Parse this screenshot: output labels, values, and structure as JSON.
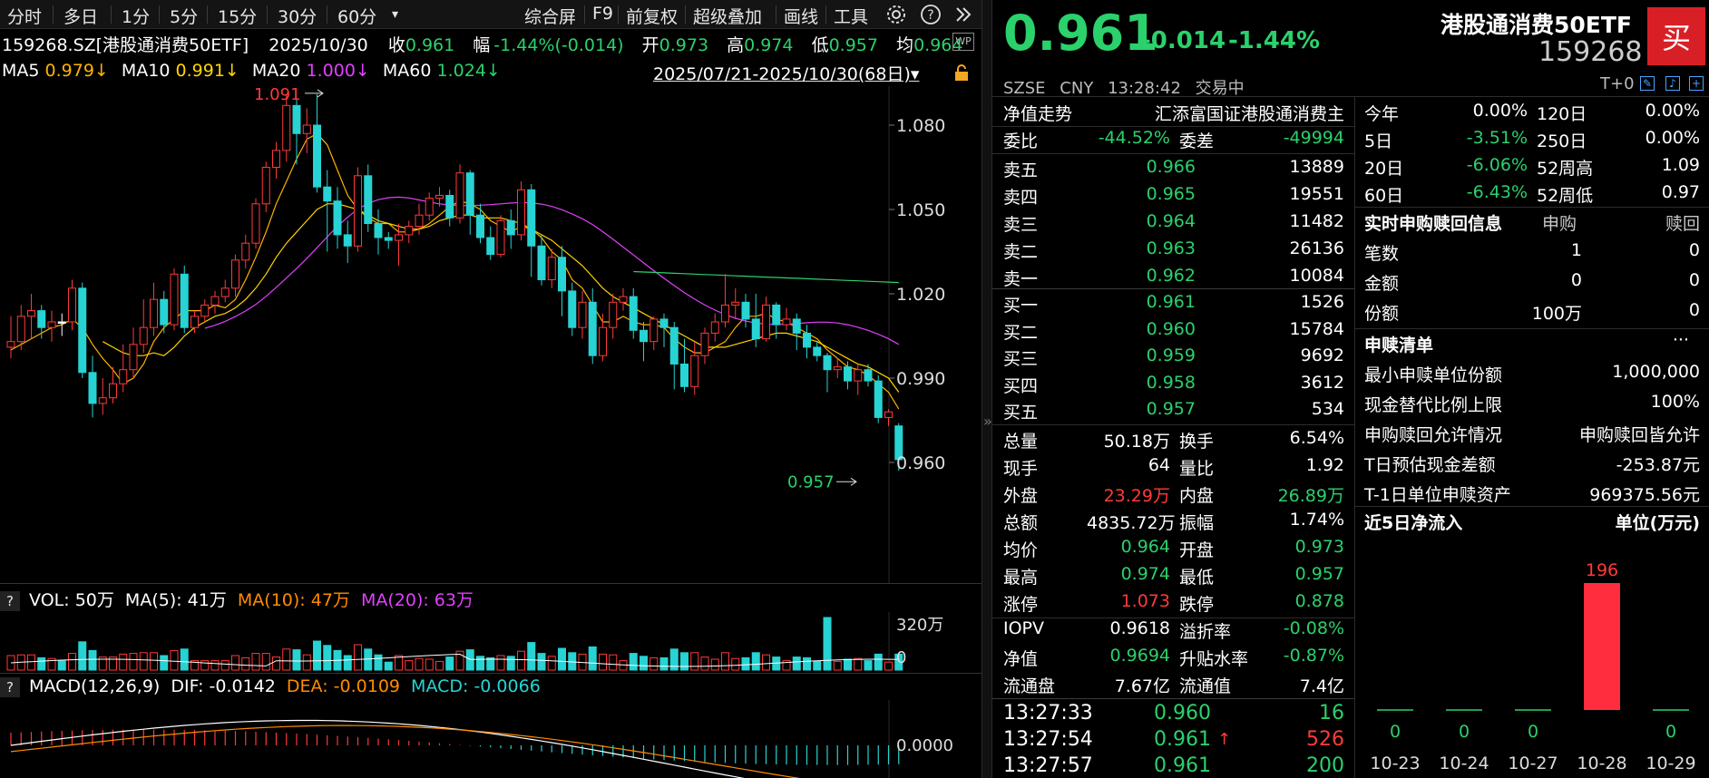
{
  "toolbar": {
    "periods": [
      "分时",
      "多日",
      "1分",
      "5分",
      "15分",
      "30分",
      "60分"
    ],
    "dropdown_symbol": "▾",
    "right_items": [
      "综合屏",
      "F9",
      "前复权",
      "超级叠加",
      "画线",
      "工具"
    ]
  },
  "quote_line": {
    "code_name": "159268.SZ[港股通消费50ETF]",
    "date": "2025/10/30",
    "close_label": "收",
    "close": "0.961",
    "change_label": "幅",
    "change": "-1.44%(-0.014)",
    "open_label": "开",
    "open": "0.973",
    "high_label": "高",
    "high": "0.974",
    "low_label": "低",
    "low": "0.957",
    "avg_label": "均",
    "avg": "0.964"
  },
  "ma_line": {
    "ma5_label": "MA5",
    "ma5": "0.979↓",
    "ma10_label": "MA10",
    "ma10": "0.991↓",
    "ma20_label": "MA20",
    "ma20": "1.000↓",
    "ma60_label": "MA60",
    "ma60": "1.024↓",
    "range": "2025/07/21-2025/10/30(68日)",
    "range_dropdown": "▾"
  },
  "chart_data": {
    "type": "candlestick",
    "price_axis_ticks": [
      "1.080",
      "1.050",
      "1.020",
      "0.990",
      "0.960"
    ],
    "max_label": "1.091",
    "min_label": "0.957",
    "colors": {
      "up": "#ff3a3a",
      "down": "#27d3d3",
      "ma5": "#ffffff",
      "ma10": "#ffd400",
      "ma20": "#e040fb",
      "ma60": "#2bd16b"
    },
    "candles": [
      [
        1.001,
        1.003,
        0.997,
        1.012
      ],
      [
        1.003,
        1.012,
        1.0,
        1.016
      ],
      [
        1.012,
        1.014,
        1.004,
        1.02
      ],
      [
        1.014,
        1.008,
        1.004,
        1.016
      ],
      [
        1.008,
        1.01,
        1.003,
        1.014
      ],
      [
        1.01,
        1.01,
        1.005,
        1.013
      ],
      [
        1.01,
        1.022,
        1.007,
        1.025
      ],
      [
        1.022,
        0.992,
        0.99,
        1.024
      ],
      [
        0.992,
        0.981,
        0.976,
        0.998
      ],
      [
        0.981,
        0.983,
        0.977,
        0.99
      ],
      [
        0.983,
        0.988,
        0.981,
        0.994
      ],
      [
        0.988,
        0.993,
        0.985,
        1.002
      ],
      [
        0.993,
        1.002,
        0.99,
        1.008
      ],
      [
        1.002,
        1.008,
        0.999,
        1.018
      ],
      [
        1.008,
        1.018,
        1.005,
        1.024
      ],
      [
        1.018,
        1.009,
        1.006,
        1.021
      ],
      [
        1.009,
        1.027,
        1.007,
        1.029
      ],
      [
        1.027,
        1.008,
        1.006,
        1.03
      ],
      [
        1.008,
        1.012,
        1.006,
        1.014
      ],
      [
        1.012,
        1.016,
        1.01,
        1.018
      ],
      [
        1.016,
        1.019,
        1.013,
        1.021
      ],
      [
        1.019,
        1.022,
        1.017,
        1.025
      ],
      [
        1.022,
        1.032,
        1.019,
        1.034
      ],
      [
        1.032,
        1.038,
        1.029,
        1.041
      ],
      [
        1.038,
        1.052,
        1.036,
        1.054
      ],
      [
        1.052,
        1.065,
        1.049,
        1.067
      ],
      [
        1.065,
        1.071,
        1.061,
        1.074
      ],
      [
        1.071,
        1.087,
        1.067,
        1.091
      ],
      [
        1.087,
        1.077,
        1.066,
        1.089
      ],
      [
        1.077,
        1.08,
        1.07,
        1.086
      ],
      [
        1.08,
        1.058,
        1.056,
        1.091
      ],
      [
        1.058,
        1.053,
        1.035,
        1.064
      ],
      [
        1.053,
        1.041,
        1.036,
        1.058
      ],
      [
        1.041,
        1.037,
        1.031,
        1.046
      ],
      [
        1.037,
        1.062,
        1.035,
        1.065
      ],
      [
        1.062,
        1.045,
        1.042,
        1.066
      ],
      [
        1.045,
        1.04,
        1.034,
        1.05
      ],
      [
        1.04,
        1.039,
        1.036,
        1.042
      ],
      [
        1.039,
        1.041,
        1.03,
        1.045
      ],
      [
        1.041,
        1.044,
        1.038,
        1.046
      ],
      [
        1.044,
        1.048,
        1.041,
        1.052
      ],
      [
        1.048,
        1.054,
        1.046,
        1.056
      ],
      [
        1.054,
        1.055,
        1.051,
        1.058
      ],
      [
        1.055,
        1.047,
        1.044,
        1.057
      ],
      [
        1.047,
        1.063,
        1.045,
        1.066
      ],
      [
        1.063,
        1.048,
        1.041,
        1.064
      ],
      [
        1.048,
        1.04,
        1.038,
        1.052
      ],
      [
        1.04,
        1.034,
        1.032,
        1.044
      ],
      [
        1.034,
        1.046,
        1.033,
        1.048
      ],
      [
        1.046,
        1.041,
        1.036,
        1.05
      ],
      [
        1.041,
        1.057,
        1.039,
        1.06
      ],
      [
        1.057,
        1.037,
        1.026,
        1.059
      ],
      [
        1.037,
        1.025,
        1.023,
        1.041
      ],
      [
        1.025,
        1.033,
        1.022,
        1.036
      ],
      [
        1.033,
        1.021,
        1.012,
        1.037
      ],
      [
        1.021,
        1.008,
        1.005,
        1.024
      ],
      [
        1.008,
        1.017,
        1.004,
        1.021
      ],
      [
        1.017,
        0.998,
        0.995,
        1.022
      ],
      [
        0.998,
        1.008,
        0.996,
        1.013
      ],
      [
        1.008,
        1.017,
        1.004,
        1.02
      ],
      [
        1.017,
        1.019,
        1.014,
        1.022
      ],
      [
        1.019,
        1.007,
        1.004,
        1.022
      ],
      [
        1.007,
        1.003,
        0.996,
        1.01
      ],
      [
        1.003,
        1.011,
        1.0,
        1.012
      ],
      [
        1.011,
        1.008,
        1.001,
        1.013
      ],
      [
        1.008,
        0.995,
        0.986,
        1.01
      ],
      [
        0.995,
        0.987,
        0.985,
        1.004
      ],
      [
        0.987,
        0.998,
        0.984,
        1.003
      ],
      [
        0.998,
        1.006,
        0.995,
        1.008
      ],
      [
        1.006,
        1.01,
        1.003,
        1.013
      ],
      [
        1.01,
        1.016,
        1.008,
        1.027
      ],
      [
        1.016,
        1.017,
        1.011,
        1.022
      ],
      [
        1.017,
        1.011,
        1.008,
        1.02
      ],
      [
        1.011,
        1.004,
        1.001,
        1.02
      ],
      [
        1.004,
        1.016,
        1.003,
        1.019
      ],
      [
        1.016,
        1.009,
        1.004,
        1.017
      ],
      [
        1.009,
        1.011,
        1.007,
        1.015
      ],
      [
        1.011,
        1.006,
        1.0,
        1.013
      ],
      [
        1.006,
        1.001,
        0.997,
        1.009
      ],
      [
        1.001,
        0.998,
        0.996,
        1.003
      ],
      [
        0.998,
        0.993,
        0.985,
        0.999
      ],
      [
        0.993,
        0.994,
        0.99,
        0.997
      ],
      [
        0.994,
        0.989,
        0.986,
        0.996
      ],
      [
        0.989,
        0.993,
        0.984,
        0.995
      ],
      [
        0.993,
        0.989,
        0.987,
        0.995
      ],
      [
        0.989,
        0.976,
        0.974,
        0.991
      ],
      [
        0.976,
        0.978,
        0.973,
        0.979
      ],
      [
        0.973,
        0.961,
        0.957,
        0.974
      ]
    ],
    "ma5": [
      1.0,
      1.002,
      1.004,
      1.006,
      1.008,
      1.009,
      1.011,
      1.008,
      1.002,
      0.997,
      0.993,
      0.988,
      0.99,
      0.995,
      1.003,
      1.008,
      1.011,
      1.014,
      1.014,
      1.014,
      1.016,
      1.015,
      1.018,
      1.025,
      1.033,
      1.042,
      1.052,
      1.06,
      1.068,
      1.075,
      1.077,
      1.073,
      1.064,
      1.055,
      1.05,
      1.047,
      1.045,
      1.045,
      1.042,
      1.042,
      1.043,
      1.045,
      1.048,
      1.051,
      1.053,
      1.052,
      1.05,
      1.046,
      1.044,
      1.042,
      1.044,
      1.043,
      1.04,
      1.035,
      1.032,
      1.025,
      1.022,
      1.016,
      1.01,
      1.01,
      1.012,
      1.01,
      1.009,
      1.009,
      1.008,
      1.004,
      1.001,
      0.999,
      0.999,
      1.001,
      1.003,
      1.008,
      1.012,
      1.012,
      1.013,
      1.011,
      1.01,
      1.008,
      1.006,
      1.004,
      1.0,
      0.997,
      0.994,
      0.993,
      0.991,
      0.988,
      0.985,
      0.979
    ],
    "ma10": [
      null,
      null,
      null,
      null,
      null,
      null,
      null,
      null,
      null,
      1.003,
      1.001,
      0.999,
      0.998,
      0.998,
      0.999,
      0.998,
      1.001,
      1.005,
      1.008,
      1.01,
      1.012,
      1.013,
      1.015,
      1.018,
      1.022,
      1.027,
      1.033,
      1.038,
      1.042,
      1.046,
      1.05,
      1.052,
      1.052,
      1.051,
      1.05,
      1.048,
      1.046,
      1.045,
      1.044,
      1.043,
      1.043,
      1.044,
      1.046,
      1.047,
      1.048,
      1.048,
      1.047,
      1.047,
      1.047,
      1.046,
      1.045,
      1.043,
      1.041,
      1.039,
      1.036,
      1.033,
      1.03,
      1.026,
      1.022,
      1.019,
      1.017,
      1.015,
      1.013,
      1.011,
      1.009,
      1.007,
      1.005,
      1.003,
      1.001,
      1.001,
      1.001,
      1.002,
      1.003,
      1.004,
      1.005,
      1.006,
      1.006,
      1.005,
      1.004,
      1.003,
      1.001,
      0.999,
      0.997,
      0.995,
      0.994,
      0.992,
      0.99,
      0.985
    ]
  },
  "axis_labels_price": {
    "t1080": "1.080",
    "t1050": "1.050",
    "t1020": "1.020",
    "t0990": "0.990",
    "t0960": "0.960"
  },
  "volume_panel": {
    "help": "?",
    "vol_label": "VOL: 50万",
    "ma5_label": "MA(5): 41万",
    "ma10_label": "MA(10): 47万",
    "ma20_label": "MA(20): 63万",
    "axis_top": "320万",
    "axis_zero": "0"
  },
  "macd_panel": {
    "help": "?",
    "title": "MACD(12,26,9)",
    "dif": "DIF: -0.0142",
    "dea": "DEA: -0.0109",
    "macd": "MACD: -0.0066",
    "axis_zero": "0.0000"
  },
  "header": {
    "price": "0.961",
    "change": "-0.014",
    "change_pct": "-1.44%",
    "name": "港股通消费50ETF",
    "code": "159268",
    "buy_badge": "买",
    "exchange": "SZSE",
    "currency": "CNY",
    "time": "13:28:42",
    "status": "交易中",
    "t0": "T+0"
  },
  "order_book": {
    "nav_tab": "净值走势",
    "index_name": "汇添富国证港股通消费主",
    "ratio_label": "委比",
    "ratio": "-44.52%",
    "diff_label": "委差",
    "diff": "-49994",
    "asks": [
      {
        "label": "卖五",
        "price": "0.966",
        "vol": "13889"
      },
      {
        "label": "卖四",
        "price": "0.965",
        "vol": "19551"
      },
      {
        "label": "卖三",
        "price": "0.964",
        "vol": "11482"
      },
      {
        "label": "卖二",
        "price": "0.963",
        "vol": "26136"
      },
      {
        "label": "卖一",
        "price": "0.962",
        "vol": "10084"
      }
    ],
    "bids": [
      {
        "label": "买一",
        "price": "0.961",
        "vol": "1526"
      },
      {
        "label": "买二",
        "price": "0.960",
        "vol": "15784"
      },
      {
        "label": "买三",
        "price": "0.959",
        "vol": "9692"
      },
      {
        "label": "买四",
        "price": "0.958",
        "vol": "3612"
      },
      {
        "label": "买五",
        "price": "0.957",
        "vol": "534"
      }
    ]
  },
  "stats": [
    {
      "l1": "总量",
      "v1": "50.18万",
      "l2": "换手",
      "v2": "6.54%",
      "c1": "wht",
      "c2": "wht"
    },
    {
      "l1": "现手",
      "v1": "64",
      "l2": "量比",
      "v2": "1.92",
      "c1": "wht",
      "c2": "wht"
    },
    {
      "l1": "外盘",
      "v1": "23.29万",
      "l2": "内盘",
      "v2": "26.89万",
      "c1": "red",
      "c2": "grn"
    },
    {
      "l1": "总额",
      "v1": "4835.72万",
      "l2": "振幅",
      "v2": "1.74%",
      "c1": "wht",
      "c2": "wht"
    },
    {
      "l1": "均价",
      "v1": "0.964",
      "l2": "开盘",
      "v2": "0.973",
      "c1": "grn",
      "c2": "grn"
    },
    {
      "l1": "最高",
      "v1": "0.974",
      "l2": "最低",
      "v2": "0.957",
      "c1": "grn",
      "c2": "grn"
    },
    {
      "l1": "涨停",
      "v1": "1.073",
      "l2": "跌停",
      "v2": "0.878",
      "c1": "red",
      "c2": "grn"
    },
    {
      "l1": "IOPV",
      "v1": "0.9618",
      "l2": "溢折率",
      "v2": "-0.08%",
      "c1": "wht",
      "c2": "grn"
    },
    {
      "l1": "净值",
      "v1": "0.9694",
      "l2": "升贴水率",
      "v2": "-0.87%",
      "c1": "grn",
      "c2": "grn"
    },
    {
      "l1": "流通盘",
      "v1": "7.67亿",
      "l2": "流通值",
      "v2": "7.4亿",
      "c1": "wht",
      "c2": "wht"
    }
  ],
  "ticks": [
    {
      "time": "13:27:33",
      "price": "0.960",
      "arrow": "",
      "vol": "16",
      "vc": "grn"
    },
    {
      "time": "13:27:54",
      "price": "0.961",
      "arrow": "↑",
      "vol": "526",
      "vc": "red"
    },
    {
      "time": "13:27:57",
      "price": "0.961",
      "arrow": "",
      "vol": "200",
      "vc": "grn"
    }
  ],
  "performance": [
    {
      "l1": "今年",
      "v1": "0.00%",
      "l2": "120日",
      "v2": "0.00%",
      "c1": "wht",
      "c2": "wht"
    },
    {
      "l1": "5日",
      "v1": "-3.51%",
      "l2": "250日",
      "v2": "0.00%",
      "c1": "grn",
      "c2": "wht"
    },
    {
      "l1": "20日",
      "v1": "-6.06%",
      "l2": "52周高",
      "v2": "1.09",
      "c1": "grn",
      "c2": "wht"
    },
    {
      "l1": "60日",
      "v1": "-6.43%",
      "l2": "52周低",
      "v2": "0.97",
      "c1": "grn",
      "c2": "wht"
    }
  ],
  "subscription": {
    "title": "实时申购赎回信息",
    "col_sub": "申购",
    "col_red": "赎回",
    "rows": [
      {
        "label": "笔数",
        "sub": "1",
        "red": "0"
      },
      {
        "label": "金额",
        "sub": "0",
        "red": "0"
      },
      {
        "label": "份额",
        "sub": "100万",
        "red": "0"
      }
    ]
  },
  "creation_list": {
    "title": "申赎清单",
    "more": "···",
    "rows": [
      {
        "label": "最小申赎单位份额",
        "value": "1,000,000"
      },
      {
        "label": "现金替代比例上限",
        "value": "100%"
      },
      {
        "label": "申购赎回允许情况",
        "value": "申购赎回皆允许"
      },
      {
        "label": "T日预估现金差额",
        "value": "-253.87元"
      },
      {
        "label": "T-1日单位申赎资产",
        "value": "969375.56元"
      }
    ]
  },
  "net_inflow": {
    "title": "近5日净流入",
    "unit": "单位(万元)",
    "bars": [
      {
        "date": "10-23",
        "value": 0
      },
      {
        "date": "10-24",
        "value": 0
      },
      {
        "date": "10-27",
        "value": 0
      },
      {
        "date": "10-28",
        "value": 196
      },
      {
        "date": "10-29",
        "value": 0
      }
    ]
  }
}
